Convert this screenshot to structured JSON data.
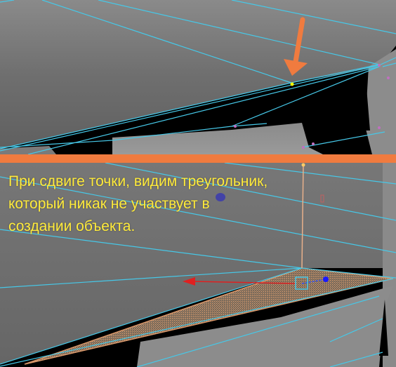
{
  "caption": {
    "lines": [
      "При сдвиге точки, видим треугольник,",
      "который никак не участвует в",
      "создании объекта."
    ]
  },
  "colors": {
    "caption_text": "#ffeb3b",
    "divider": "#f07b3f",
    "arrow_marker": "#f07b3f",
    "wireframe": "#46c8e8",
    "mesh_fill": "#707070",
    "background_gap": "#000000",
    "selected_face": "#d9976a",
    "move_gizmo_x_axis": "#e02020",
    "move_gizmo_pivot": "#1a1aff",
    "vertex": "#c070c0",
    "highlighted_vertex": "#ffff00"
  },
  "icons": {
    "top_panel_marker": "orange-arrow-icon",
    "move_gizmo": "move-gizmo-icon"
  }
}
